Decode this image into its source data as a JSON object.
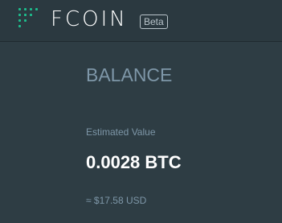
{
  "header": {
    "logo_text": "FCOIN",
    "beta_badge": "Beta",
    "brand_color": "#1dbd8c"
  },
  "balance": {
    "title": "BALANCE",
    "estimated_label": "Estimated Value",
    "btc_value": "0.0028 BTC",
    "usd_value": "≈ $17.58 USD"
  }
}
